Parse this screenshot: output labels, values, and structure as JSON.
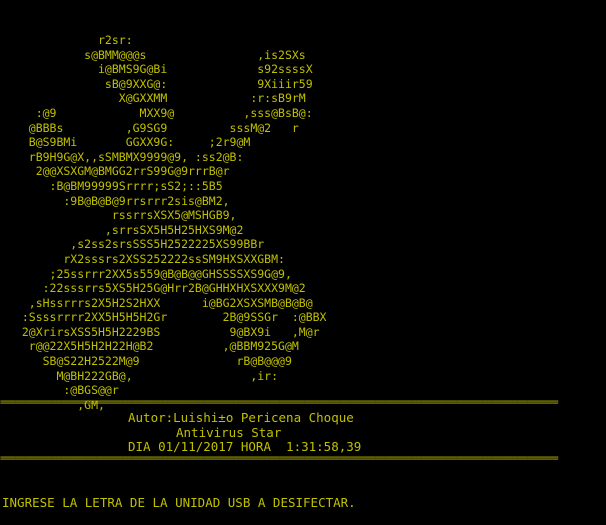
{
  "console": {
    "background": "#000000",
    "text_color": "#c0c000",
    "ascii_art": [
      "             r2sr:",
      "           s@BMM@@@s                ,is2SXs",
      "             i@BMS9G@Bi             s92ssssX",
      "              sB@9XXG@:             9Xiiir59",
      "                X@GXXMM            :r:sB9rM",
      "    :@9            MXX9@          ,sss@BsB@:",
      "   @BBBs         ,G9SG9         sssM@2   r",
      "   B@S9BMi       GGXX9G:     ;2r9@M",
      "   rB9H9G@X,,sSMBMX9999@9, :ss2@B:",
      "    2@@XSXGM@BMGG2rrS99G@9rrrB@r",
      "      :B@BM99999Srrrr;sS2;::5B5",
      "        :9B@B@B@9rrsrrr2sis@BM2,",
      "               rssrrsXSX5@MSHGB9,",
      "              ,srrsSX5H5H25HXS9M@2",
      "         ,s2ss2srsSSS5H2522225XS99BBr",
      "        rX2sssrs2XSS252222ssSM9HXSXXGBM:",
      "      ;25ssrrr2XX5s559@B@B@@GHSSSSXS9G@9,",
      "     :22sssrrs5XS5H25G@Hrr2B@GHHXHXSXXX9M@2",
      "   ,sHssrrrs2X5H2S2HXX      i@BG2XSXSMB@B@B@",
      "  :Ssssrrrr2XX5H5H5H2Gr        2B@9SSGr  :@BBX",
      "  2@XrirsXSS5H5H2229BS          9@BX9i   ,M@r",
      "   r@@22X5H5H2H22H@B2          ,@BBM925G@M",
      "     SB@S22H2522M@9              rB@B@@@9",
      "       M@BH222GB@,                 ,ir:",
      "        :@BGS@@r",
      "          ,GM,"
    ],
    "separator_top": "==============================================================================================================",
    "author_line": "Autor:Luishi±o Pericena Choque",
    "app_name": "Antivirus Star",
    "date_line": "DIA 01/11/2017 HORA  1:31:58,39",
    "separator_bottom": "==============================================================================================================",
    "prompt": "INGRESE LA LETRA DE LA UNIDAD USB A DESIFECTAR."
  }
}
